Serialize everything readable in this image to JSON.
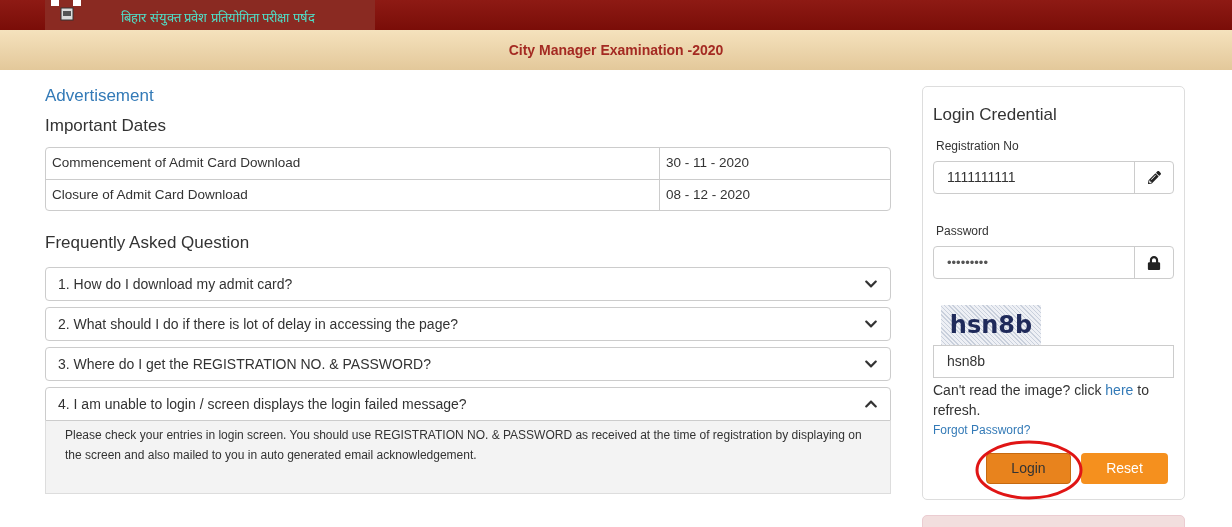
{
  "header": {
    "org_name": "बिहार संयुक्त प्रवेश प्रतियोगिता परीक्षा पर्षद",
    "exam_title": "City Manager Examination -2020"
  },
  "advertisement_link": "Advertisement",
  "important_dates": {
    "heading": "Important Dates",
    "rows": [
      {
        "event": "Commencement of Admit Card Download",
        "date": "30 - 11 - 2020"
      },
      {
        "event": "Closure of Admit Card Download",
        "date": "08 - 12 - 2020"
      }
    ]
  },
  "faq": {
    "heading": "Frequently Asked Question",
    "items": [
      {
        "question": "1. How do I download my admit card?",
        "expanded": false
      },
      {
        "question": "2. What should I do if there is lot of delay in accessing the page?",
        "expanded": false
      },
      {
        "question": "3. Where do I get the REGISTRATION NO. & PASSWORD?",
        "expanded": false
      },
      {
        "question": "4. I am unable to login / screen displays the login failed message?",
        "expanded": true,
        "answer": "Please check your entries in login screen. You should use REGISTRATION NO. & PASSWORD as received at the time of registration by displaying on the screen and also mailed to you in auto generated email acknowledgement."
      }
    ]
  },
  "login": {
    "heading": "Login Credential",
    "registration_label": "Registration No",
    "registration_value": "1111111111",
    "password_label": "Password",
    "password_value": "•••••••••",
    "captcha_text": "hsn8b",
    "captcha_value": "hsn8b",
    "refresh_before": "Can't read the image? click",
    "refresh_link": "here",
    "refresh_after": "to refresh.",
    "forgot_link": "Forgot Password?",
    "login_button": "Login",
    "reset_button": "Reset",
    "login_circled": true
  }
}
